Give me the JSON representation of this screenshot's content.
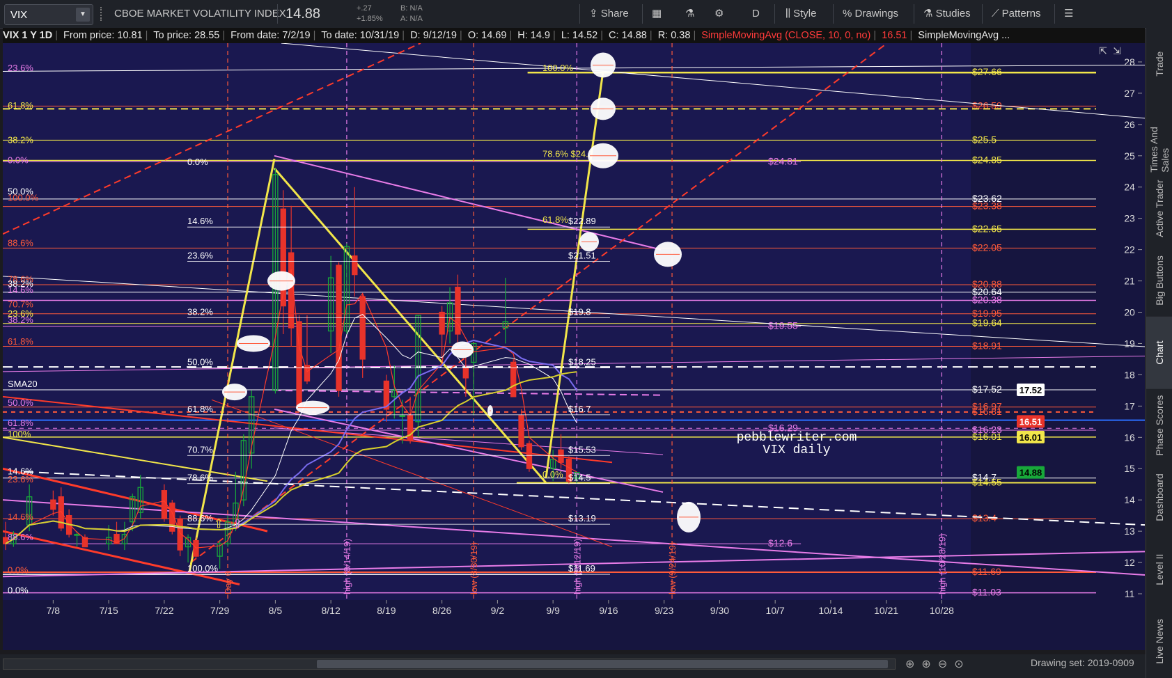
{
  "toolbar": {
    "symbol": "VIX",
    "name": "CBOE MARKET VOLATILITY INDEX",
    "last": "14.88",
    "change": "+.27",
    "change_pct": "+1.85%",
    "bid": "B: N/A",
    "ask": "A: N/A",
    "share": "Share",
    "period": "D",
    "style": "Style",
    "drawings": "Drawings",
    "studies": "Studies",
    "patterns": "Patterns"
  },
  "infobar": {
    "title": "VIX 1 Y 1D",
    "from_price": "From price: 10.81",
    "to_price": "To price: 28.55",
    "from_date": "From date: 7/2/19",
    "to_date": "To date: 10/31/19",
    "d": "D: 9/12/19",
    "o": "O: 14.69",
    "h": "H: 14.9",
    "l": "L: 14.52",
    "c": "C: 14.88",
    "r": "R: 0.38",
    "study1": "SimpleMovingAvg (CLOSE, 10, 0, no)",
    "study1_val": "16.51",
    "study2": "SimpleMovingAvg ..."
  },
  "right_tabs": [
    "Trade",
    "Times And Sales",
    "Active Trader",
    "Big Buttons",
    "Chart",
    "Phase Scores",
    "Dashboard",
    "Level II",
    "Live News"
  ],
  "bottom": {
    "drawing_set": "Drawing set: 2019-0909"
  },
  "colors": {
    "bg": "#1a1850",
    "up": "#18a83a",
    "down": "#e8332a",
    "fib_magenta": "#e87ce8",
    "fib_yellow": "#f2e64a",
    "fib_red": "#ff5a3a",
    "white": "#ffffff"
  },
  "chart_data": {
    "type": "candlestick",
    "watermark": [
      "pebblewriter.com",
      "VIX daily"
    ],
    "y_ticks": [
      11,
      12,
      13,
      14,
      15,
      16,
      17,
      18,
      19,
      20,
      21,
      22,
      23,
      24,
      25,
      26,
      27,
      28
    ],
    "ylim": [
      10.8,
      28.6
    ],
    "x_ticks": [
      "7/8",
      "7/15",
      "7/22",
      "7/29",
      "8/5",
      "8/12",
      "8/19",
      "8/26",
      "9/2",
      "9/9",
      "9/16",
      "9/23",
      "9/30",
      "10/7",
      "10/14",
      "10/21",
      "10/28"
    ],
    "price_tags": [
      {
        "label": "17.52",
        "value": 17.52,
        "color": "#ffffff",
        "text": "#000000"
      },
      {
        "label": "16.51",
        "value": 16.51,
        "color": "#e8332a",
        "text": "#ffffff"
      },
      {
        "label": "16.01",
        "value": 16.01,
        "color": "#f2e64a",
        "text": "#000000"
      },
      {
        "label": "14.88",
        "value": 14.88,
        "color": "#18a83a",
        "text": "#000000"
      }
    ],
    "candles": [
      {
        "d": "7/2",
        "o": 12.8,
        "h": 13.3,
        "l": 12.4,
        "c": 12.6
      },
      {
        "d": "7/3",
        "o": 12.6,
        "h": 13.0,
        "l": 12.5,
        "c": 12.9
      },
      {
        "d": "7/5",
        "o": 13.2,
        "h": 14.5,
        "l": 13.0,
        "c": 14.1
      },
      {
        "d": "7/8",
        "o": 14.0,
        "h": 14.3,
        "l": 13.5,
        "c": 13.7
      },
      {
        "d": "7/9",
        "o": 14.1,
        "h": 14.4,
        "l": 13.0,
        "c": 13.1
      },
      {
        "d": "7/10",
        "o": 13.5,
        "h": 13.7,
        "l": 12.8,
        "c": 12.9
      },
      {
        "d": "7/11",
        "o": 12.9,
        "h": 13.0,
        "l": 12.5,
        "c": 12.9
      },
      {
        "d": "7/12",
        "o": 12.8,
        "h": 12.9,
        "l": 12.5,
        "c": 12.5
      },
      {
        "d": "7/15",
        "o": 12.6,
        "h": 13.2,
        "l": 12.4,
        "c": 12.8
      },
      {
        "d": "7/16",
        "o": 12.9,
        "h": 13.3,
        "l": 12.6,
        "c": 12.6
      },
      {
        "d": "7/17",
        "o": 12.6,
        "h": 13.3,
        "l": 12.4,
        "c": 12.9
      },
      {
        "d": "7/18",
        "o": 13.3,
        "h": 14.2,
        "l": 13.0,
        "c": 14.1
      },
      {
        "d": "7/19",
        "o": 13.6,
        "h": 14.8,
        "l": 13.4,
        "c": 14.4
      },
      {
        "d": "7/22",
        "o": 14.3,
        "h": 14.5,
        "l": 13.3,
        "c": 13.4
      },
      {
        "d": "7/23",
        "o": 13.9,
        "h": 14.0,
        "l": 12.9,
        "c": 13.0
      },
      {
        "d": "7/24",
        "o": 13.4,
        "h": 13.5,
        "l": 12.2,
        "c": 12.4
      },
      {
        "d": "7/25",
        "o": 12.5,
        "h": 12.9,
        "l": 12.0,
        "c": 12.8
      },
      {
        "d": "7/26",
        "o": 12.7,
        "h": 12.8,
        "l": 12.1,
        "c": 12.2
      },
      {
        "d": "7/29",
        "o": 12.2,
        "h": 12.7,
        "l": 11.8,
        "c": 12.6
      },
      {
        "d": "7/30",
        "o": 12.6,
        "h": 13.5,
        "l": 12.5,
        "c": 13.3
      },
      {
        "d": "7/31",
        "o": 13.2,
        "h": 14.9,
        "l": 13.0,
        "c": 13.9
      },
      {
        "d": "8/1",
        "o": 14.0,
        "h": 16.1,
        "l": 13.8,
        "c": 15.9
      },
      {
        "d": "8/2",
        "o": 15.5,
        "h": 17.5,
        "l": 15.0,
        "c": 17.3
      },
      {
        "d": "8/5",
        "o": 17.5,
        "h": 24.6,
        "l": 17.4,
        "c": 24.4
      },
      {
        "d": "8/6",
        "o": 23.3,
        "h": 23.9,
        "l": 19.3,
        "c": 20.2
      },
      {
        "d": "8/7",
        "o": 21.9,
        "h": 23.4,
        "l": 18.9,
        "c": 19.5
      },
      {
        "d": "8/8",
        "o": 19.7,
        "h": 19.9,
        "l": 17.0,
        "c": 17.0
      },
      {
        "d": "8/9",
        "o": 18.3,
        "h": 19.9,
        "l": 17.7,
        "c": 17.8
      },
      {
        "d": "8/12",
        "o": 19.4,
        "h": 21.8,
        "l": 18.7,
        "c": 21.1
      },
      {
        "d": "8/13",
        "o": 21.5,
        "h": 21.6,
        "l": 17.3,
        "c": 17.5
      },
      {
        "d": "8/14",
        "o": 19.4,
        "h": 22.2,
        "l": 19.3,
        "c": 22.1
      },
      {
        "d": "8/15",
        "o": 21.8,
        "h": 24.0,
        "l": 20.5,
        "c": 21.2
      },
      {
        "d": "8/16",
        "o": 20.5,
        "h": 20.6,
        "l": 17.9,
        "c": 18.5
      },
      {
        "d": "8/19",
        "o": 17.8,
        "h": 18.0,
        "l": 16.5,
        "c": 16.9
      },
      {
        "d": "8/20",
        "o": 17.3,
        "h": 18.3,
        "l": 16.6,
        "c": 17.5
      },
      {
        "d": "8/21",
        "o": 16.7,
        "h": 17.2,
        "l": 15.8,
        "c": 16.7
      },
      {
        "d": "8/22",
        "o": 16.7,
        "h": 17.3,
        "l": 15.8,
        "c": 15.9
      },
      {
        "d": "8/23",
        "o": 16.5,
        "h": 19.9,
        "l": 16.0,
        "c": 19.9
      },
      {
        "d": "8/26",
        "o": 20.0,
        "h": 20.2,
        "l": 18.5,
        "c": 19.3
      },
      {
        "d": "8/27",
        "o": 19.4,
        "h": 20.8,
        "l": 19.0,
        "c": 20.3
      },
      {
        "d": "8/28",
        "o": 20.8,
        "h": 21.2,
        "l": 18.9,
        "c": 19.3
      },
      {
        "d": "8/29",
        "o": 18.2,
        "h": 18.6,
        "l": 17.3,
        "c": 17.9
      },
      {
        "d": "8/30",
        "o": 18.4,
        "h": 19.0,
        "l": 16.7,
        "c": 19.0
      },
      {
        "d": "9/3",
        "o": 19.5,
        "h": 21.1,
        "l": 19.0,
        "c": 19.7
      },
      {
        "d": "9/4",
        "o": 18.4,
        "h": 18.5,
        "l": 17.3,
        "c": 17.3
      },
      {
        "d": "9/5",
        "o": 16.7,
        "h": 16.9,
        "l": 15.6,
        "c": 15.7
      },
      {
        "d": "9/6",
        "o": 15.8,
        "h": 15.9,
        "l": 14.9,
        "c": 15.0
      },
      {
        "d": "9/9",
        "o": 15.0,
        "h": 15.6,
        "l": 14.6,
        "c": 15.3
      },
      {
        "d": "9/10",
        "o": 15.6,
        "h": 16.1,
        "l": 15.0,
        "c": 15.2
      },
      {
        "d": "9/11",
        "o": 15.3,
        "h": 15.4,
        "l": 14.5,
        "c": 14.6
      },
      {
        "d": "9/12",
        "o": 14.69,
        "h": 14.9,
        "l": 14.52,
        "c": 14.88
      }
    ],
    "hlines": [
      {
        "value": 27.66,
        "color": "#f2e64a",
        "width": 2.5,
        "x0": 0.48,
        "x1": 1.0,
        "label": "$27.66",
        "lblColor": "#f2e64a"
      },
      {
        "value": 26.59,
        "color": "#ff5a3a",
        "width": 1,
        "x0": 0.0,
        "x1": 1.0,
        "label": "$26.59",
        "lblColor": "#ff5a3a"
      },
      {
        "value": 26.5,
        "color": "#f2e64a",
        "width": 2,
        "dash": "10 6",
        "x0": 0.0,
        "x1": 1.0,
        "label": "",
        "lblColor": "#f2e64a"
      },
      {
        "value": 25.5,
        "color": "#f2e64a",
        "width": 1,
        "x0": 0.0,
        "x1": 1.0,
        "label": "$25.5",
        "lblColor": "#f2e64a"
      },
      {
        "value": 24.85,
        "color": "#f2e64a",
        "width": 1.5,
        "x0": 0.0,
        "x1": 1.0,
        "label": "$24.85",
        "lblColor": "#f2e64a"
      },
      {
        "value": 24.81,
        "color": "#e87ce8",
        "width": 1,
        "x0": 0.0,
        "x1": 0.73,
        "label": "$24.81",
        "lblColor": "#e87ce8",
        "lblX": 0.7
      },
      {
        "value": 23.62,
        "color": "#ffffff",
        "width": 1,
        "x0": 0.0,
        "x1": 1.0,
        "label": "$23.62",
        "lblColor": "#ffffff"
      },
      {
        "value": 23.38,
        "color": "#ff5a3a",
        "width": 1,
        "x0": 0.0,
        "x1": 1.0,
        "label": "$23.38",
        "lblColor": "#ff5a3a"
      },
      {
        "value": 22.65,
        "color": "#f2e64a",
        "width": 1.5,
        "x0": 0.48,
        "x1": 1.0,
        "label": "$22.65",
        "lblColor": "#f2e64a"
      },
      {
        "value": 22.05,
        "color": "#ff5a3a",
        "width": 1,
        "x0": 0.0,
        "x1": 1.0,
        "label": "$22.05",
        "lblColor": "#ff5a3a"
      },
      {
        "value": 20.88,
        "color": "#ff5a3a",
        "width": 1,
        "x0": 0.0,
        "x1": 1.0,
        "label": "$20.88",
        "lblColor": "#ff5a3a"
      },
      {
        "value": 20.64,
        "color": "#ffffff",
        "width": 1,
        "x0": 0.0,
        "x1": 1.0,
        "label": "$20.64",
        "lblColor": "#ffffff"
      },
      {
        "value": 20.38,
        "color": "#e87ce8",
        "width": 1.5,
        "x0": 0.0,
        "x1": 1.0,
        "label": "$20.38",
        "lblColor": "#e87ce8"
      },
      {
        "value": 19.95,
        "color": "#ff5a3a",
        "width": 1,
        "x0": 0.0,
        "x1": 1.0,
        "label": "$19.95",
        "lblColor": "#ff5a3a"
      },
      {
        "value": 19.64,
        "color": "#f2e64a",
        "width": 1,
        "x0": 0.0,
        "x1": 1.0,
        "label": "$19.64",
        "lblColor": "#f2e64a"
      },
      {
        "value": 19.55,
        "color": "#e87ce8",
        "width": 1,
        "x0": 0.0,
        "x1": 0.73,
        "label": "$19.55",
        "lblColor": "#e87ce8",
        "lblX": 0.7
      },
      {
        "value": 18.91,
        "color": "#ff5a3a",
        "width": 1,
        "x0": 0.0,
        "x1": 1.0,
        "label": "$18.91",
        "lblColor": "#ff5a3a"
      },
      {
        "value": 18.25,
        "color": "#ffffff",
        "width": 2,
        "dash": "14 8",
        "x0": 0.0,
        "x1": 1.0,
        "label": "",
        "lblColor": "#ffffff"
      },
      {
        "value": 17.52,
        "color": "#ffffff",
        "width": 1,
        "x0": 0.0,
        "x1": 1.0,
        "label": "$17.52",
        "lblColor": "#ffffff"
      },
      {
        "value": 16.97,
        "color": "#ff5a3a",
        "width": 1,
        "x0": 0.0,
        "x1": 1.0,
        "label": "$16.97",
        "lblColor": "#ff5a3a"
      },
      {
        "value": 16.81,
        "color": "#ff5a3a",
        "width": 2,
        "dash": "6 6",
        "x0": 0.0,
        "x1": 1.0,
        "label": "$16.81",
        "lblColor": "#ff5a3a"
      },
      {
        "value": 16.29,
        "color": "#e87ce8",
        "width": 1,
        "dash": "6 6",
        "x0": 0.0,
        "x1": 1.0,
        "label": "$16.29",
        "lblColor": "#e87ce8",
        "lblX": 0.7
      },
      {
        "value": 16.23,
        "color": "#e87ce8",
        "width": 1,
        "x0": 0.0,
        "x1": 1.0,
        "label": "$16.23",
        "lblColor": "#e87ce8"
      },
      {
        "value": 16.01,
        "color": "#f2e64a",
        "width": 1.5,
        "x0": 0.0,
        "x1": 1.0,
        "label": "$16.01",
        "lblColor": "#f2e64a"
      },
      {
        "value": 14.7,
        "color": "#ffffff",
        "width": 1,
        "x0": 0.0,
        "x1": 1.0,
        "label": "$14.7",
        "lblColor": "#ffffff"
      },
      {
        "value": 14.55,
        "color": "#f2e64a",
        "width": 2,
        "x0": 0.47,
        "x1": 1.0,
        "label": "$14.55",
        "lblColor": "#f2e64a"
      },
      {
        "value": 13.4,
        "color": "#ff5a3a",
        "width": 1,
        "x0": 0.0,
        "x1": 1.0,
        "label": "$13.4",
        "lblColor": "#ff5a3a"
      },
      {
        "value": 12.6,
        "color": "#e87ce8",
        "width": 1,
        "x0": 0.0,
        "x1": 0.73,
        "label": "$12.6",
        "lblColor": "#e87ce8",
        "lblX": 0.7
      },
      {
        "value": 11.69,
        "color": "#ff5a3a",
        "width": 2,
        "x0": 0.0,
        "x1": 1.0,
        "label": "$11.69",
        "lblColor": "#ff5a3a"
      },
      {
        "value": 11.62,
        "color": "#ffffff",
        "width": 1.5,
        "x0": 0.0,
        "x1": 0.53,
        "label": "",
        "lblColor": "#ffffff"
      },
      {
        "value": 11.03,
        "color": "#e87ce8",
        "width": 1.5,
        "x0": 0.0,
        "x1": 1.0,
        "label": "$11.03",
        "lblColor": "#e87ce8"
      }
    ],
    "fib_left": [
      {
        "label": "23.6%",
        "value": 27.8,
        "color": "#e87ce8"
      },
      {
        "label": "61.8%",
        "value": 26.6,
        "color": "#f2e64a"
      },
      {
        "label": "38.2%",
        "value": 25.5,
        "color": "#f2e64a"
      },
      {
        "label": "0.0%",
        "value": 24.85,
        "color": "#e87ce8"
      },
      {
        "label": "50.0%",
        "value": 23.85,
        "color": "#ffffff"
      },
      {
        "label": "100.0%",
        "value": 23.65,
        "color": "#ff5a3a"
      },
      {
        "label": "88.6%",
        "value": 22.2,
        "color": "#ff5a3a"
      },
      {
        "label": "78.6%",
        "value": 21.05,
        "color": "#ff5a3a"
      },
      {
        "label": "38.2%",
        "value": 20.9,
        "color": "#ffffff"
      },
      {
        "label": "14.6%",
        "value": 20.7,
        "color": "#e87ce8"
      },
      {
        "label": "70.7%",
        "value": 20.25,
        "color": "#ff5a3a"
      },
      {
        "label": "23.6%",
        "value": 19.95,
        "color": "#f2e64a"
      },
      {
        "label": "38.2%",
        "value": 19.75,
        "color": "#e87ce8"
      },
      {
        "label": "61.8%",
        "value": 19.05,
        "color": "#ff5a3a"
      },
      {
        "label": "SMA20",
        "value": 17.7,
        "color": "#ffffff"
      },
      {
        "label": "50.0%",
        "value": 17.1,
        "color": "#e87ce8"
      },
      {
        "label": "61.8%",
        "value": 16.45,
        "color": "#e87ce8"
      },
      {
        "label": "100%",
        "value": 16.1,
        "color": "#f2e64a"
      },
      {
        "label": "14.6%",
        "value": 14.9,
        "color": "#ffffff"
      },
      {
        "label": "23.6%",
        "value": 14.65,
        "color": "#ff5a3a"
      },
      {
        "label": "14.6%",
        "value": 13.45,
        "color": "#ff5a3a"
      },
      {
        "label": "88.6%",
        "value": 12.8,
        "color": "#e87ce8"
      },
      {
        "label": "0.0%",
        "value": 11.75,
        "color": "#ff5a3a"
      },
      {
        "label": "0.0%",
        "value": 11.1,
        "color": "#ffffff"
      }
    ],
    "fib_mid": [
      {
        "label": "0.0%",
        "value": 24.8,
        "color": "#ffffff"
      },
      {
        "label": "14.6%",
        "value": 22.9,
        "color": "#ffffff"
      },
      {
        "label": "23.6%",
        "value": 21.8,
        "color": "#ffffff"
      },
      {
        "label": "38.2%",
        "value": 20.0,
        "color": "#ffffff"
      },
      {
        "label": "50.0%",
        "value": 18.4,
        "color": "#ffffff"
      },
      {
        "label": "61.8%",
        "value": 16.9,
        "color": "#ffffff"
      },
      {
        "label": "70.7%",
        "value": 15.6,
        "color": "#ffffff"
      },
      {
        "label": "78.6%",
        "value": 14.7,
        "color": "#ffffff"
      },
      {
        "label": "88.6%",
        "value": 13.4,
        "color": "#ffffff"
      },
      {
        "label": "100.0%",
        "value": 11.8,
        "color": "#ffffff"
      }
    ],
    "fib_right": [
      {
        "label": "$22.89",
        "value": 22.9
      },
      {
        "label": "$21.51",
        "value": 21.8
      },
      {
        "label": "$19.8",
        "value": 20.0
      },
      {
        "label": "$18.25",
        "value": 18.4
      },
      {
        "label": "$16.7",
        "value": 16.9
      },
      {
        "label": "$15.53",
        "value": 15.6
      },
      {
        "label": "$14.5",
        "value": 14.7
      },
      {
        "label": "$13.19",
        "value": 13.4
      },
      {
        "label": "$11.69",
        "value": 11.8
      }
    ],
    "fib_yellow_right": [
      {
        "label": "100.0%",
        "value": 27.8
      },
      {
        "label": "78.6% $24.1",
        "value": 25.05
      },
      {
        "label": "61.8%",
        "value": 22.95
      },
      {
        "label": "0.0%",
        "value": 14.8
      }
    ],
    "vlines": [
      {
        "date": "7/30",
        "label": "Day 0",
        "color": "#ff5a3a",
        "dash": "6 5"
      },
      {
        "date": "8/14",
        "label": "high (8/14/19)",
        "color": "#e87ce8",
        "dash": "6 5"
      },
      {
        "date": "8/30",
        "label": "low (8/30/19)",
        "color": "#ff5a3a",
        "dash": "6 5"
      },
      {
        "date": "9/12",
        "label": "high (9/12/19)",
        "color": "#e87ce8",
        "dash": "6 5"
      },
      {
        "date": "9/24",
        "label": "low (9/24/19)",
        "color": "#ff5a3a",
        "dash": "6 5"
      },
      {
        "date": "10/28",
        "label": "high (10/28/19)",
        "color": "#e87ce8",
        "dash": "6 5"
      }
    ]
  }
}
